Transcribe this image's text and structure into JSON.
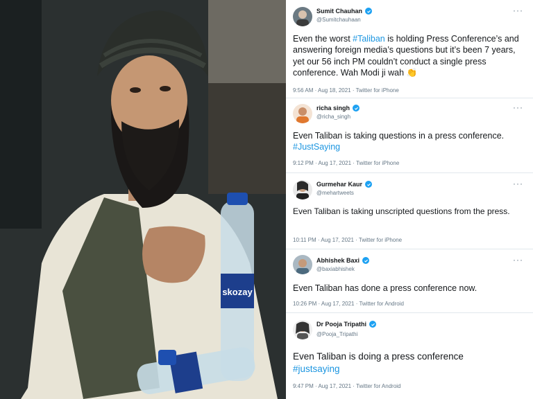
{
  "tweets": [
    {
      "name": "Sumit Chauhan",
      "handle": "@Sumitchauhaan",
      "text_parts": [
        "Even the worst ",
        "#Taliban",
        " is holding Press Conference’s and answering foreign media’s questions but it’s been 7 years, yet our 56 inch PM couldn’t conduct a single press conference. Wah Modi ji wah ",
        "👏"
      ],
      "timestamp": "9:56 AM · Aug 18, 2021 · Twitter for iPhone",
      "more": "···",
      "avatar_color": "#6b7a83"
    },
    {
      "name": "richa singh",
      "handle": "@richa_singh",
      "text_parts": [
        "Even Taliban is taking questions in a press conference.",
        "#JustSaying"
      ],
      "timestamp": "9:12 PM · Aug 17, 2021 · Twitter for iPhone",
      "more": "···",
      "avatar_color": "#e0782f"
    },
    {
      "name": "Gurmehar Kaur",
      "handle": "@mehartweets",
      "text": "Even Taliban is taking unscripted questions from the press.",
      "timestamp": "10:11 PM · Aug 17, 2021 · Twitter for iPhone",
      "more": "···",
      "avatar_color": "#2a2a2a"
    },
    {
      "name": "Abhishek Baxi",
      "handle": "@baxiabhishek",
      "text": "Even Taliban has done a press conference now.",
      "timestamp": "10:26 PM · Aug 17, 2021 · Twitter for Android",
      "more": "···",
      "avatar_color": "#4c6a7e"
    },
    {
      "name": "Dr Pooja Tripathi",
      "handle": "@Pooja_Tripathi",
      "text_parts": [
        "Even Taliban is doing a press conference",
        "#justsaying"
      ],
      "timestamp": "9:47 PM · Aug 17, 2021 · Twitter for Android",
      "more": "···",
      "avatar_color": "#333333"
    }
  ],
  "photo": {
    "bottle_label_1": "skozay",
    "bottle_label_2": "skozay"
  },
  "colors": {
    "link": "#1b95e0",
    "verified": "#1da1f2",
    "text": "#14171a",
    "muted": "#657786"
  }
}
